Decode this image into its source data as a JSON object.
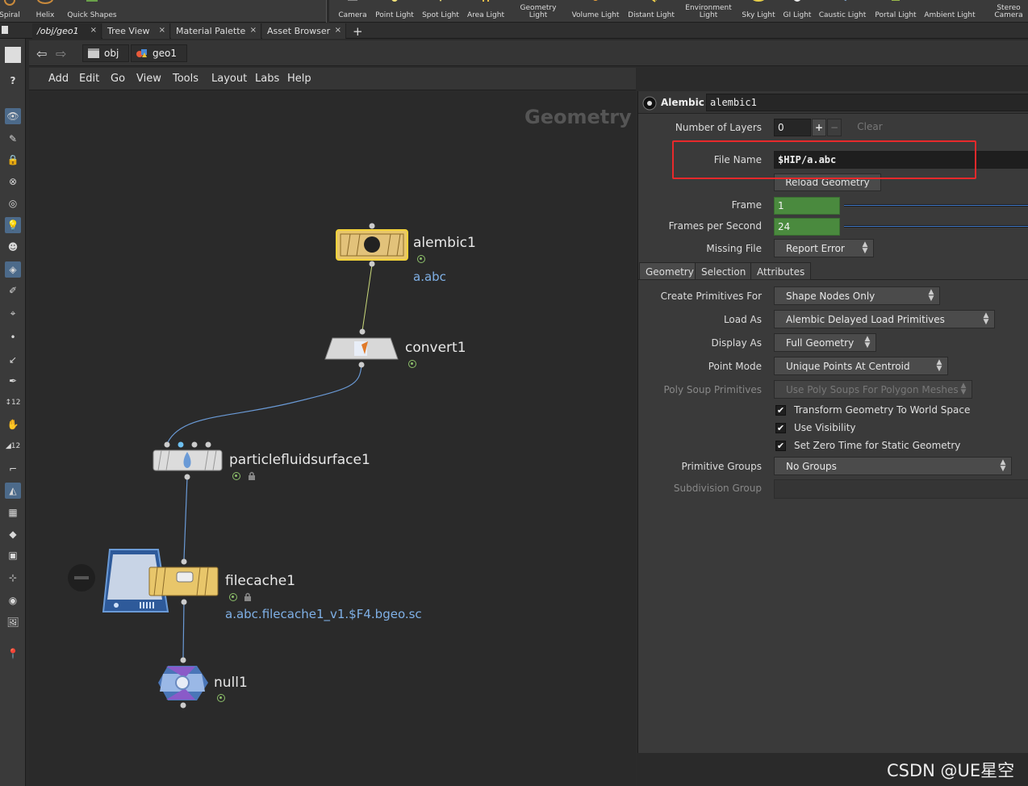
{
  "shelf": {
    "tools": [
      {
        "label": "Spiral"
      },
      {
        "label": "Helix"
      },
      {
        "label": "Quick Shapes"
      },
      {
        "label": "Camera"
      },
      {
        "label": "Point Light"
      },
      {
        "label": "Spot Light"
      },
      {
        "label": "Area Light"
      },
      {
        "label": "Geometry Light"
      },
      {
        "label": "Volume Light"
      },
      {
        "label": "Distant Light"
      },
      {
        "label": "Environment Light"
      },
      {
        "label": "Sky Light"
      },
      {
        "label": "GI Light"
      },
      {
        "label": "Caustic Light"
      },
      {
        "label": "Portal Light"
      },
      {
        "label": "Ambient Light"
      },
      {
        "label": "Stereo Camera"
      }
    ]
  },
  "tabs": [
    {
      "label": "/obj/geo1",
      "close": "×"
    },
    {
      "label": "Tree View",
      "close": "×"
    },
    {
      "label": "Material Palette",
      "close": "×"
    },
    {
      "label": "Asset Browser",
      "close": "×"
    }
  ],
  "tab_add": "+",
  "path": {
    "back": "⇦",
    "forward": "⇨",
    "crumbs": [
      "obj",
      "geo1"
    ]
  },
  "menu": [
    "Add",
    "Edit",
    "Go",
    "View",
    "Tools",
    "Layout",
    "Labs",
    "Help"
  ],
  "network": {
    "context_label": "Geometry",
    "nodes": {
      "alembic": {
        "name": "alembic1",
        "sub": "a.abc"
      },
      "convert": {
        "name": "convert1"
      },
      "pfs": {
        "name": "particlefluidsurface1"
      },
      "filecache": {
        "name": "filecache1",
        "sub": "a.abc.filecache1_v1.$F4.bgeo.sc"
      },
      "null": {
        "name": "null1"
      }
    }
  },
  "params": {
    "node_type": "Alembic",
    "node_name": "alembic1",
    "num_layers_label": "Number of Layers",
    "num_layers_value": "0",
    "plus": "+",
    "minus": "−",
    "clear": "Clear",
    "file_name_label": "File Name",
    "file_name_value": "$HIP/a.abc",
    "reload": "Reload Geometry",
    "frame_label": "Frame",
    "frame_value": "1",
    "fps_label": "Frames per Second",
    "fps_value": "24",
    "missing_file_label": "Missing File",
    "missing_file_value": "Report Error",
    "tabs": [
      "Geometry",
      "Selection",
      "Attributes"
    ],
    "create_prims_label": "Create Primitives For",
    "create_prims_value": "Shape Nodes Only",
    "load_as_label": "Load As",
    "load_as_value": "Alembic Delayed Load Primitives",
    "display_as_label": "Display As",
    "display_as_value": "Full Geometry",
    "point_mode_label": "Point Mode",
    "point_mode_value": "Unique Points At Centroid",
    "poly_soup_label": "Poly Soup Primitives",
    "poly_soup_value": "Use Poly Soups For Polygon Meshes",
    "check_transform": "Transform Geometry To World Space",
    "check_visibility": "Use Visibility",
    "check_zero_time": "Set Zero Time for Static Geometry",
    "prim_groups_label": "Primitive Groups",
    "prim_groups_value": "No Groups",
    "subdiv_group_label": "Subdivision Group",
    "checkmark": "✔",
    "arrows": "▴▾"
  },
  "watermark": "CSDN @UE星空"
}
